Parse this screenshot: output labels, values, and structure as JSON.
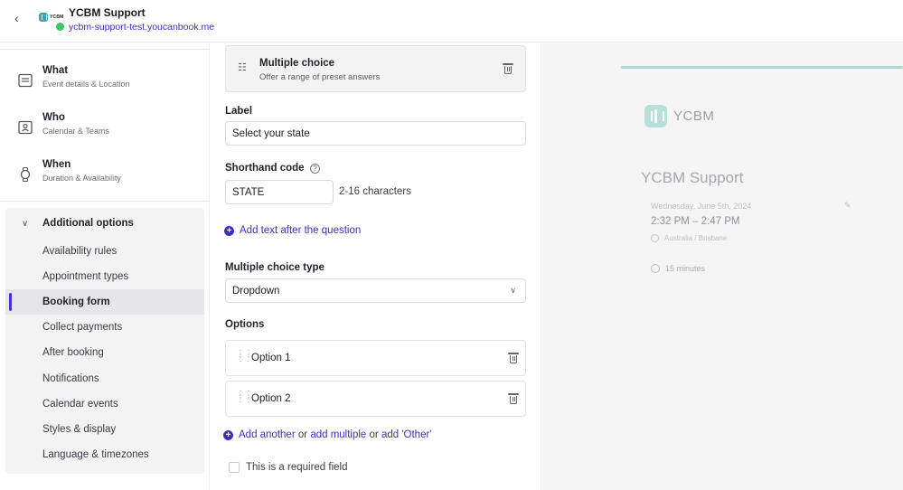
{
  "header": {
    "back_icon": "chevron-left-icon",
    "logo_text": "YCBM",
    "title": "YCBM Support",
    "url": "ycbm-support-test.youcanbook.me",
    "status_color": "#3cc66a"
  },
  "sidebar": {
    "main_items": [
      {
        "title": "What",
        "subtitle": "Event details & Location",
        "icon": "calendar-details-icon"
      },
      {
        "title": "Who",
        "subtitle": "Calendar & Teams",
        "icon": "person-card-icon"
      },
      {
        "title": "When",
        "subtitle": "Duration & Availability",
        "icon": "watch-icon"
      }
    ],
    "advanced": {
      "label": "Additional options",
      "items": [
        "Availability rules",
        "Appointment types",
        "Booking form",
        "Collect payments",
        "After booking",
        "Notifications",
        "Calendar events",
        "Styles & display",
        "Language & timezones"
      ],
      "active": "Booking form"
    }
  },
  "form": {
    "question_type": {
      "title": "Multiple choice",
      "subtitle": "Offer a range of preset answers"
    },
    "label": {
      "label": "Label",
      "value": "Select your state"
    },
    "shorthand": {
      "label": "Shorthand code",
      "value": "STATE",
      "hint": "2-16 characters"
    },
    "add_text_link": "Add text after the question",
    "mc_type": {
      "label": "Multiple choice type",
      "value": "Dropdown"
    },
    "options": {
      "label": "Options",
      "items": [
        "Option 1",
        "Option 2"
      ]
    },
    "add_row": {
      "add_another": "Add another",
      "or1": "or",
      "add_multiple": "add multiple",
      "or2": "or",
      "add_other": "add 'Other'"
    },
    "required_label": "This is a required field"
  },
  "preview": {
    "logo_text": "YCBM",
    "title": "YCBM Support",
    "date": "Wednesday, June 5th, 2024",
    "time": "2:32 PM – 2:47 PM",
    "timezone": "Australia / Brisbane",
    "duration": "15 minutes",
    "accent_color": "#a8d9d3"
  },
  "colors": {
    "brand": "#3d2fbf",
    "active_bar": "#4b33d1"
  }
}
